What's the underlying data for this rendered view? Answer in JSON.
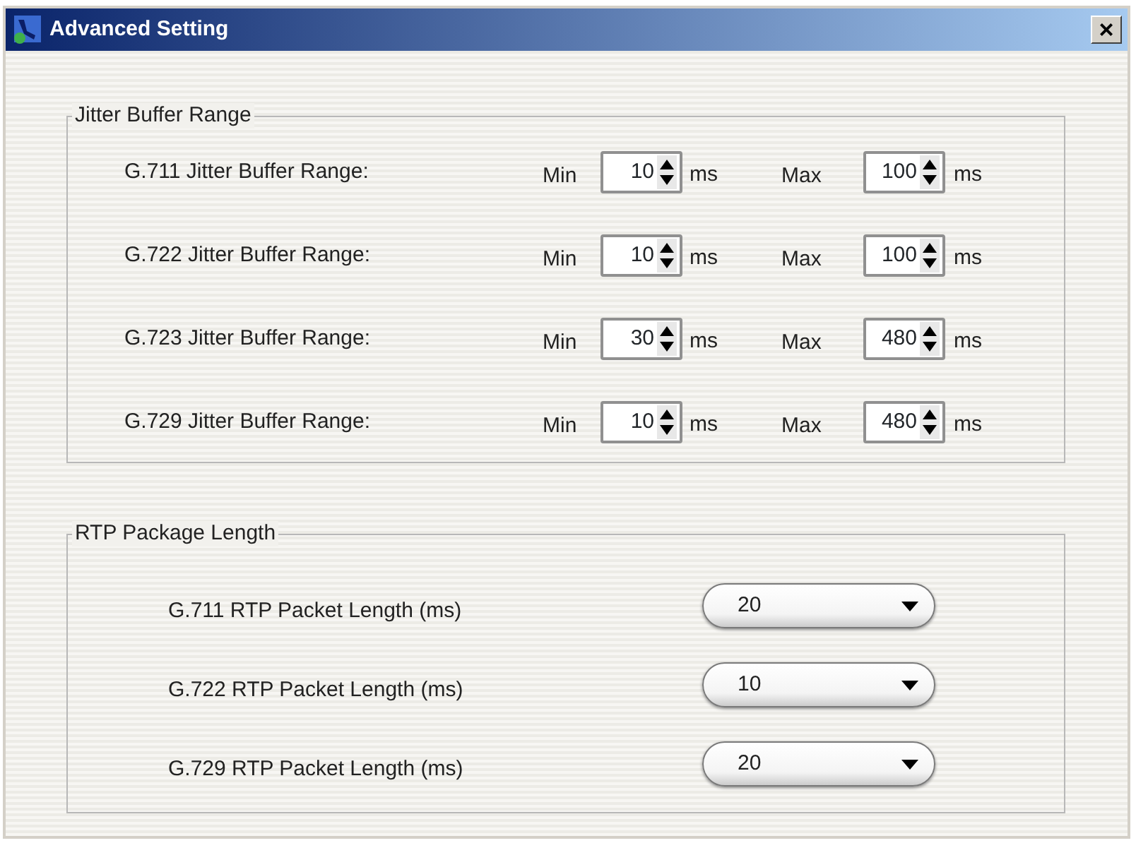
{
  "window": {
    "title": "Advanced Setting",
    "close": "×"
  },
  "jitter_buffer": {
    "title": "Jitter Buffer Range",
    "rows": [
      {
        "label": "G.711 Jitter Buffer Range:",
        "min_label": "Min",
        "min": "10",
        "min_unit": "ms",
        "max_label": "Max",
        "max": "100",
        "max_unit": "ms"
      },
      {
        "label": "G.722 Jitter Buffer Range:",
        "min_label": "Min",
        "min": "10",
        "min_unit": "ms",
        "max_label": "Max",
        "max": "100",
        "max_unit": "ms"
      },
      {
        "label": "G.723 Jitter Buffer Range:",
        "min_label": "Min",
        "min": "30",
        "min_unit": "ms",
        "max_label": "Max",
        "max": "480",
        "max_unit": "ms"
      },
      {
        "label": "G.729 Jitter Buffer Range:",
        "min_label": "Min",
        "min": "10",
        "min_unit": "ms",
        "max_label": "Max",
        "max": "480",
        "max_unit": "ms"
      }
    ]
  },
  "rtp_package": {
    "title": "RTP Package Length",
    "rows": [
      {
        "label": "G.711 RTP Packet Length (ms)",
        "value": "20"
      },
      {
        "label": "G.722 RTP Packet Length (ms)",
        "value": "10"
      },
      {
        "label": "G.729 RTP Packet Length (ms)",
        "value": "20"
      }
    ]
  }
}
